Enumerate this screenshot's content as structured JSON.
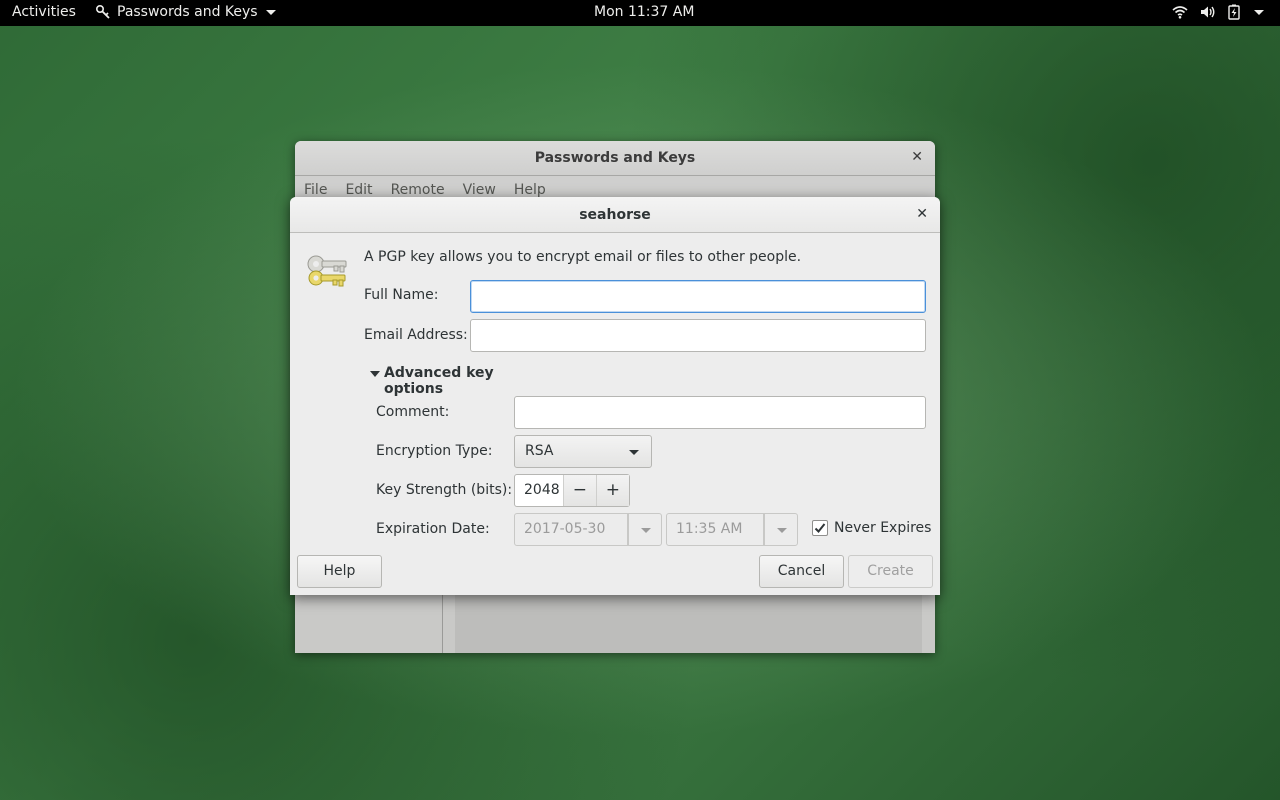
{
  "topbar": {
    "activities": "Activities",
    "app_menu": "Passwords and Keys",
    "clock": "Mon 11:37 AM",
    "status_icons": [
      "wifi-icon",
      "volume-icon",
      "battery-icon",
      "menu-caret-icon"
    ]
  },
  "main_window": {
    "title": "Passwords and Keys",
    "menus": [
      "File",
      "Edit",
      "Remote",
      "View",
      "Help"
    ]
  },
  "dialog": {
    "title": "seahorse",
    "intro": "A PGP key allows you to encrypt email or files to other people.",
    "full_name_label": "Full Name:",
    "full_name_value": "",
    "email_label": "Email Address:",
    "email_value": "",
    "advanced_label": "Advanced key options",
    "comment_label": "Comment:",
    "comment_value": "",
    "encryption_label": "Encryption Type:",
    "encryption_value": "RSA",
    "strength_label": "Key Strength (bits):",
    "strength_value": "2048",
    "strength_minus": "−",
    "strength_plus": "+",
    "expiration_label": "Expiration Date:",
    "expiration_date": "2017-05-30",
    "expiration_time": "11:35 AM",
    "never_expires_label": "Never Expires",
    "never_expires_checked": true,
    "help_button": "Help",
    "cancel_button": "Cancel",
    "create_button": "Create"
  }
}
